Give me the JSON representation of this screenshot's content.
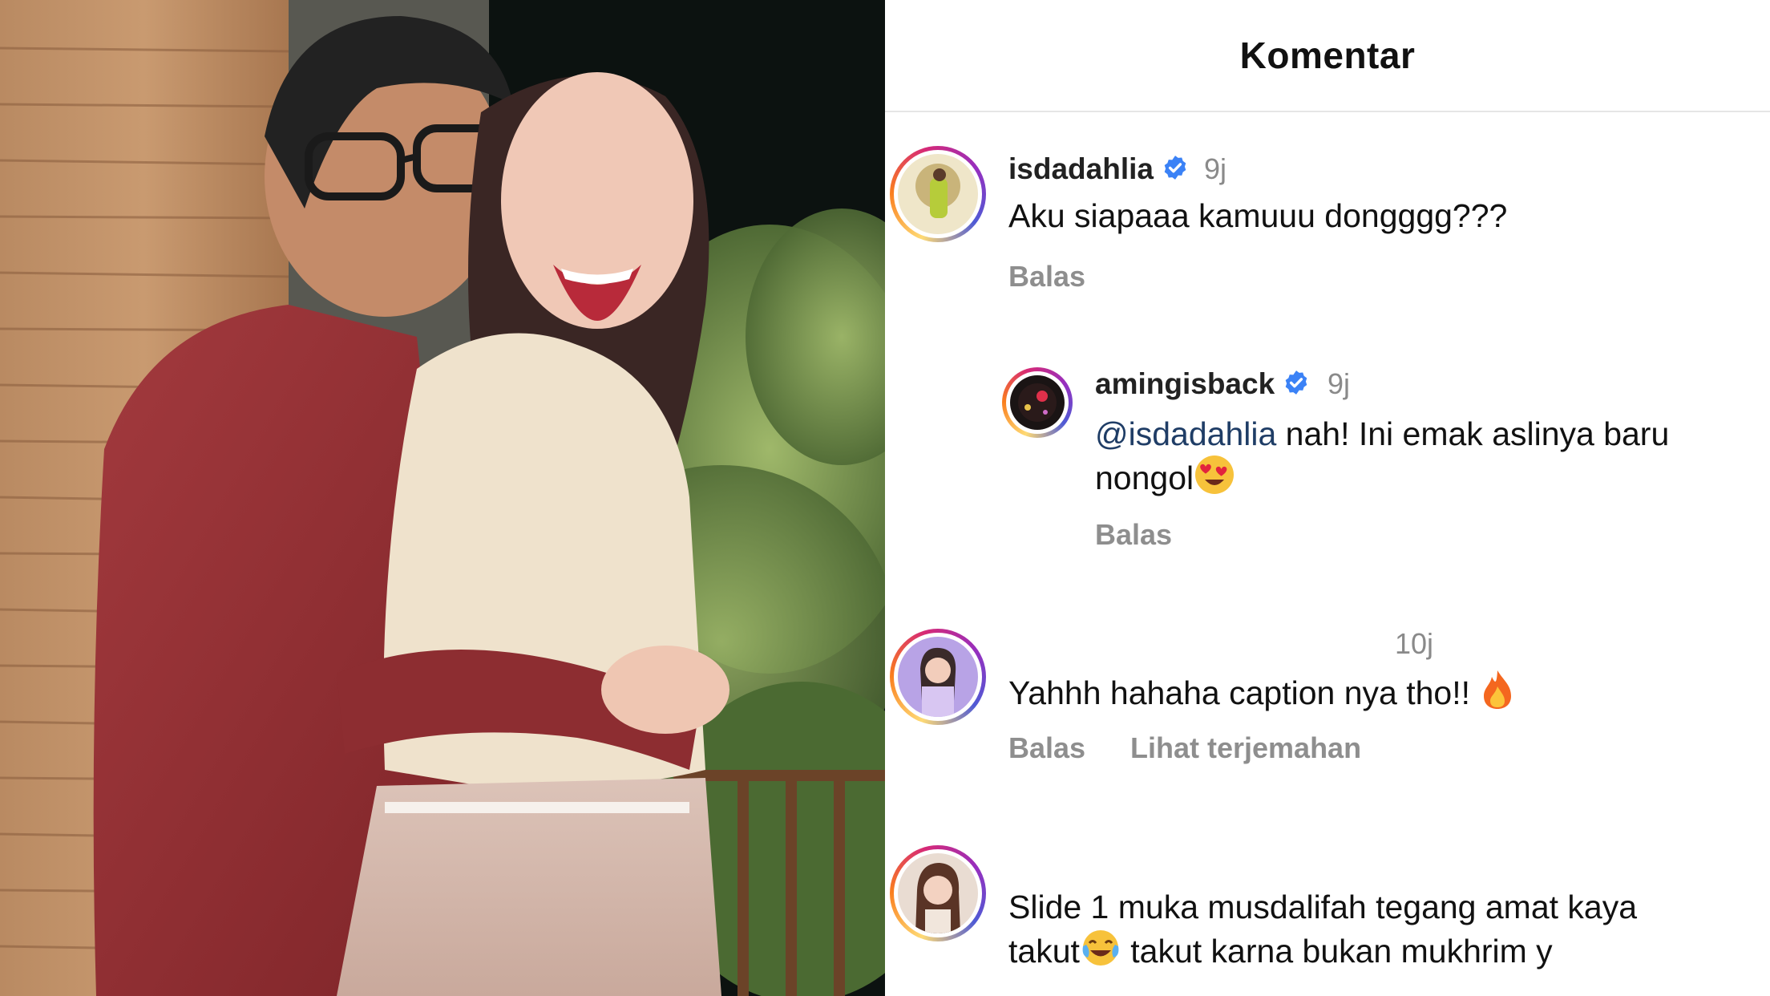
{
  "header": {
    "title": "Komentar"
  },
  "comments": [
    {
      "username": "isdadahlia",
      "verified": true,
      "time": "9j",
      "text": "Aku siapaaa kamuuu dongggg???",
      "reply_label": "Balas"
    },
    {
      "username": "amingisback",
      "verified": true,
      "time": "9j",
      "mention": "@isdadahlia",
      "text_line1": " nah! Ini emak aslinya baru",
      "text_line2": "nongol",
      "emoji": "heart-eyes",
      "reply_label": "Balas",
      "is_reply": true
    },
    {
      "username": "",
      "time": "10j",
      "text": "Yahhh hahaha caption nya tho!! ",
      "emoji": "fire",
      "reply_label": "Balas",
      "translate_label": "Lihat terjemahan"
    },
    {
      "username": "",
      "text_line1": "Slide 1 muka musdalifah tegang amat kaya",
      "text_line2a": "takut",
      "emoji": "tears-of-joy",
      "text_line2b": " takut karna bukan mukhrim y"
    }
  ],
  "colors": {
    "verified_blue": "#3b82f6",
    "mention": "#1f3d66",
    "muted": "#8e8e8e",
    "story_ring": [
      "#feda75",
      "#fa7e1e",
      "#d62976",
      "#962fbf",
      "#4f5bd5"
    ]
  }
}
